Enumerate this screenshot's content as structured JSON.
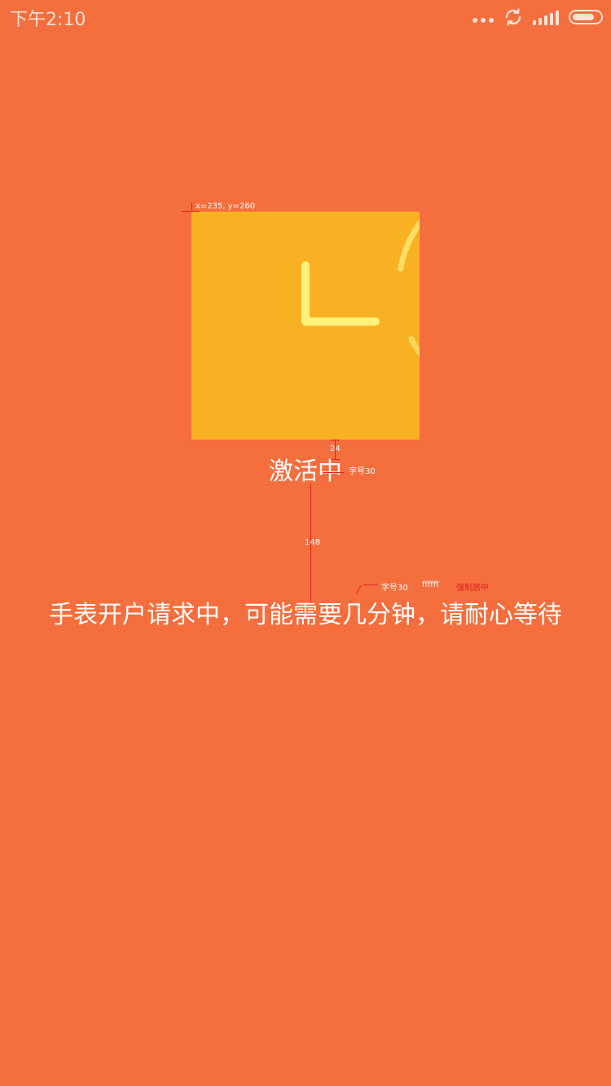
{
  "status_bar": {
    "time": "下午2:10",
    "icons": [
      "more-dots-icon",
      "sync-icon",
      "signal-icon",
      "battery-icon"
    ],
    "battery_level": 0.8
  },
  "activation": {
    "title": "激活中",
    "hint": "手表开户请求中，可能需要几分钟，请耐心等待",
    "clock_icon": "clock-icon"
  },
  "annotations": {
    "coord_label": "x=235, y=260",
    "gap_small": "24",
    "font_note_title": "字号30",
    "gap_large": "148",
    "font_note_hint": "字号30",
    "color_note": "ffffff",
    "center_note": "强制居中"
  },
  "colors": {
    "background": "#f56e3e",
    "clock_box": "#f9b124",
    "clock_ring": "#fde26a",
    "clock_hands": "#fff27a",
    "text": "#ffffff",
    "annotation_red": "#e02020"
  }
}
